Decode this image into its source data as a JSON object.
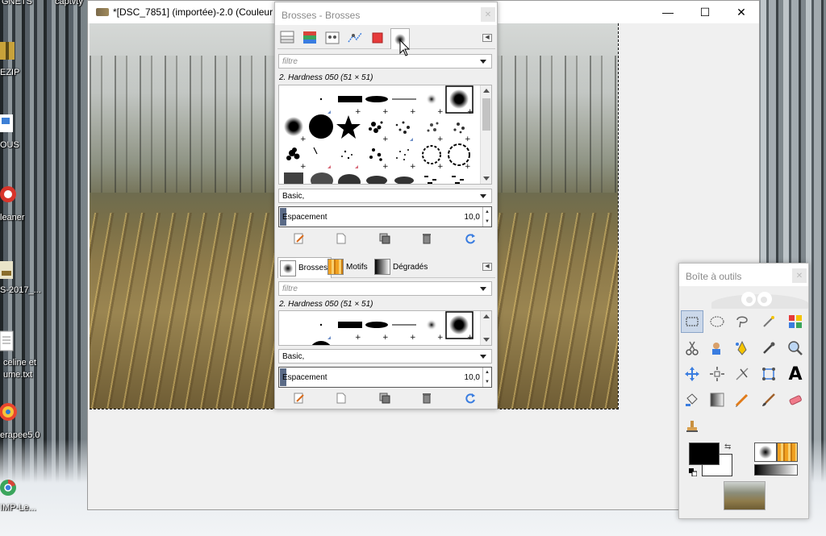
{
  "desktop": {
    "icons": [
      {
        "label": "GNETS",
        "icon": "folder-icon"
      },
      {
        "label": "captvty",
        "icon": "app-icon"
      },
      {
        "label": "EZIP",
        "icon": "archive-icon"
      },
      {
        "label": "OUS",
        "icon": "document-icon"
      },
      {
        "label": "leaner",
        "icon": "ccleaner-icon"
      },
      {
        "label": "S-2017_...",
        "icon": "document-icon"
      },
      {
        "label": "celine et",
        "icon": "text-file-icon"
      },
      {
        "label": "ume.txt",
        "icon": "text-file-icon"
      },
      {
        "label": "erapee5.0",
        "icon": "rawtherapee-icon"
      },
      {
        "label": "IMP-Le...",
        "icon": "chrome-icon"
      }
    ]
  },
  "image_window": {
    "title": "*[DSC_7851] (importée)-2.0 (Couleur R",
    "minimize": "—",
    "maximize": "☐",
    "close": "✕"
  },
  "brushes_dock": {
    "title": "Brosses - Brosses",
    "close": "✕",
    "top_tabs": [
      {
        "name": "layers-icon"
      },
      {
        "name": "channels-icon"
      },
      {
        "name": "paths-icon"
      },
      {
        "name": "undo-history-icon"
      },
      {
        "name": "colormap-icon"
      },
      {
        "name": "brushes-icon",
        "active": true
      }
    ],
    "filter_placeholder": "filtre",
    "selected_brush": "2. Hardness 050 (51 × 51)",
    "preset": "Basic,",
    "spacing_label": "Espacement",
    "spacing_value": "10,0",
    "spacing_fraction": 0.03,
    "bottom_tabs": [
      {
        "label": "Brosses",
        "active": true
      },
      {
        "label": "Motifs"
      },
      {
        "label": "Dégradés"
      }
    ],
    "bottom_filter_placeholder": "filtre",
    "bottom_selected_brush": "2. Hardness 050 (51 × 51)",
    "bottom_preset": "Basic,",
    "bottom_spacing_label": "Espacement",
    "bottom_spacing_value": "10,0",
    "actions": [
      {
        "name": "edit-brush-icon"
      },
      {
        "name": "new-brush-icon"
      },
      {
        "name": "duplicate-brush-icon"
      },
      {
        "name": "delete-brush-icon"
      },
      {
        "name": "refresh-brushes-icon"
      }
    ]
  },
  "toolbox": {
    "title": "Boîte à outils",
    "close": "✕",
    "tools": [
      {
        "name": "rect-select-tool",
        "active": true
      },
      {
        "name": "ellipse-select-tool"
      },
      {
        "name": "free-select-tool"
      },
      {
        "name": "fuzzy-select-tool"
      },
      {
        "name": "color-select-tool"
      },
      {
        "name": "scissors-tool"
      },
      {
        "name": "foreground-select-tool"
      },
      {
        "name": "paths-tool"
      },
      {
        "name": "color-picker-tool"
      },
      {
        "name": "zoom-tool"
      },
      {
        "name": "move-tool"
      },
      {
        "name": "align-tool"
      },
      {
        "name": "crop-tool"
      },
      {
        "name": "unified-transform-tool"
      },
      {
        "name": "text-tool"
      },
      {
        "name": "bucket-fill-tool"
      },
      {
        "name": "gradient-tool"
      },
      {
        "name": "pencil-tool"
      },
      {
        "name": "paintbrush-tool"
      },
      {
        "name": "eraser-tool"
      },
      {
        "name": "clone-tool"
      }
    ],
    "text_tool_glyph": "A",
    "swap_glyph": "⇆",
    "colors": {
      "foreground": "#000000",
      "background": "#ffffff"
    }
  }
}
